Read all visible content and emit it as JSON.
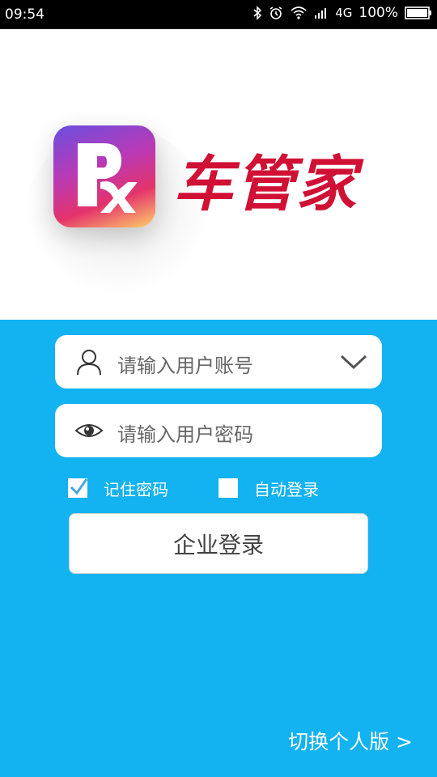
{
  "status_bar": {
    "time": "09:54",
    "network": "4G",
    "battery": "100%"
  },
  "app": {
    "name": "车管家",
    "brand_color": "#d01035",
    "panel_color": "#13b2f0"
  },
  "login": {
    "account_placeholder": "请输入用户账号",
    "password_placeholder": "请输入用户密码",
    "remember_label": "记住密码",
    "remember_checked": true,
    "auto_login_label": "自动登录",
    "auto_login_checked": false,
    "submit_label": "企业登录"
  },
  "footer": {
    "switch_label": "切换个人版 >"
  }
}
